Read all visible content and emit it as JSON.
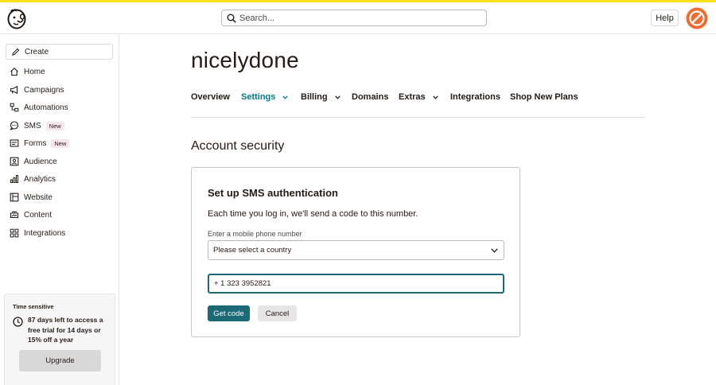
{
  "header": {
    "search_placeholder": "Search...",
    "help_label": "Help"
  },
  "sidebar": {
    "create_label": "Create",
    "items": [
      {
        "label": "Home",
        "icon": "home-icon"
      },
      {
        "label": "Campaigns",
        "icon": "megaphone-icon"
      },
      {
        "label": "Automations",
        "icon": "automation-icon"
      },
      {
        "label": "SMS",
        "icon": "sms-icon",
        "badge": "New"
      },
      {
        "label": "Forms",
        "icon": "form-icon",
        "badge": "New"
      },
      {
        "label": "Audience",
        "icon": "audience-icon"
      },
      {
        "label": "Analytics",
        "icon": "analytics-icon"
      },
      {
        "label": "Website",
        "icon": "website-icon"
      },
      {
        "label": "Content",
        "icon": "content-icon"
      },
      {
        "label": "Integrations",
        "icon": "integrations-icon"
      }
    ],
    "trial": {
      "label": "Time sensitive",
      "message": "87 days left to access a free trial for 14 days or 15% off a year",
      "upgrade_label": "Upgrade"
    }
  },
  "main": {
    "account_name": "nicelydone",
    "tabs": [
      {
        "label": "Overview",
        "dropdown": false,
        "active": false
      },
      {
        "label": "Settings",
        "dropdown": true,
        "active": true
      },
      {
        "label": "Billing",
        "dropdown": true,
        "active": false
      },
      {
        "label": "Domains",
        "dropdown": false,
        "active": false
      },
      {
        "label": "Extras",
        "dropdown": true,
        "active": false
      },
      {
        "label": "Integrations",
        "dropdown": false,
        "active": false
      },
      {
        "label": "Shop New Plans",
        "dropdown": false,
        "active": false
      }
    ],
    "section_title": "Account security",
    "sms_card": {
      "title": "Set up SMS authentication",
      "description": "Each time you log in, we'll send a code to this number.",
      "phone_label": "Enter a mobile phone number",
      "country_value": "Please select a country",
      "phone_value": "+ 1 323 3952821",
      "get_code_label": "Get code",
      "cancel_label": "Cancel"
    }
  },
  "colors": {
    "brand_yellow": "#ffe01b",
    "accent_teal": "#007c89",
    "button_teal": "#1b6a75",
    "avatar_orange": "#ef6b2f",
    "badge_pink": "#f8e5ee"
  }
}
